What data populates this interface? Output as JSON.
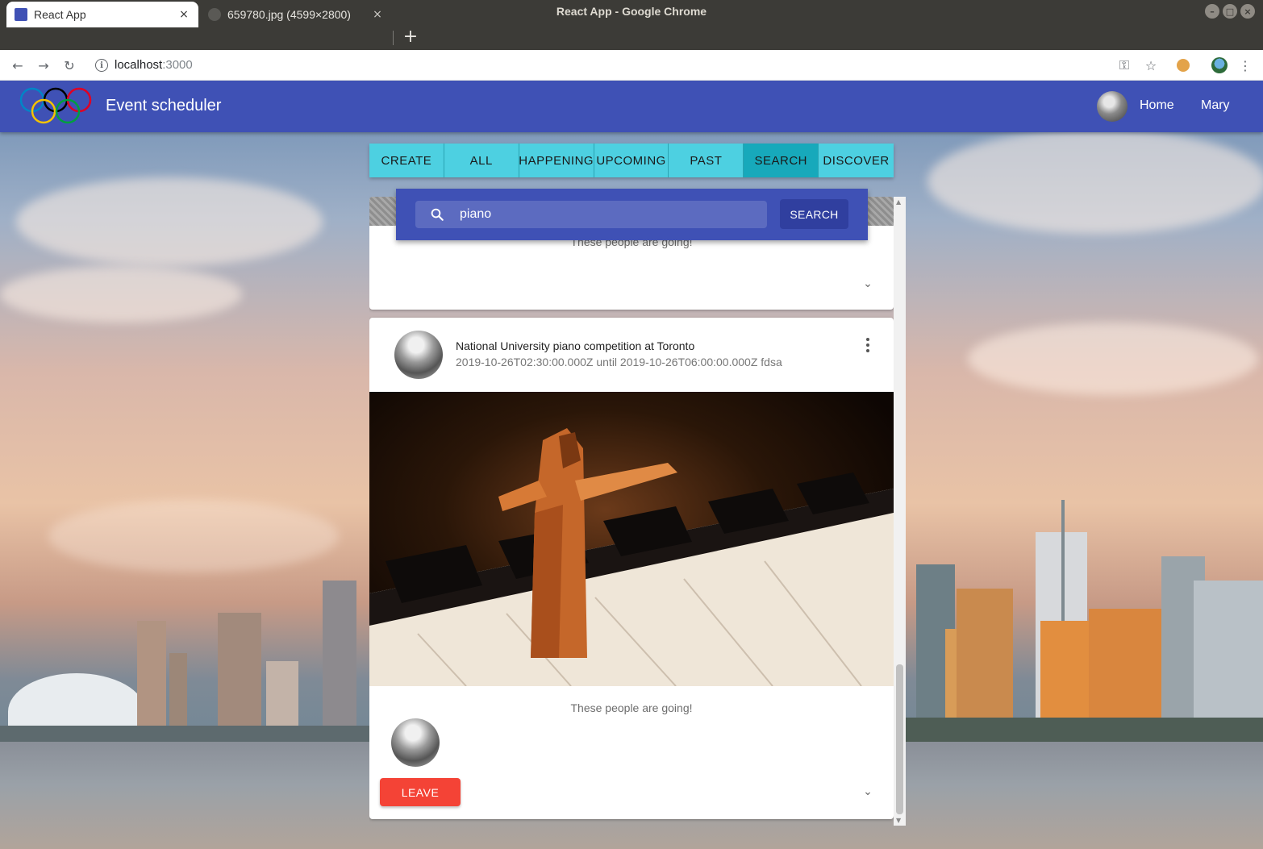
{
  "window": {
    "title": "React App - Google Chrome"
  },
  "tabs": [
    {
      "title": "React App",
      "close": "×"
    },
    {
      "title": "659780.jpg (4599×2800)",
      "close": "×"
    }
  ],
  "toolbar": {
    "url_host": "localhost",
    "url_port": ":3000",
    "icons": [
      "back-icon",
      "forward-icon",
      "reload-icon",
      "info-icon",
      "key-icon",
      "star-icon",
      "cookie-icon",
      "profile-icon",
      "menu-icon"
    ]
  },
  "appbar": {
    "title": "Event scheduler",
    "nav": {
      "home": "Home",
      "user": "Mary"
    }
  },
  "filters": {
    "items": [
      "CREATE",
      "ALL",
      "HAPPENING",
      "UPCOMING",
      "PAST",
      "SEARCH",
      "DISCOVER"
    ],
    "selected": "SEARCH"
  },
  "search": {
    "query": "piano",
    "button": "SEARCH"
  },
  "events": [
    {
      "going_label": "These people are going!"
    },
    {
      "title": "National University piano competition at Toronto",
      "subtitle": "2019-10-26T02:30:00.000Z until 2019-10-26T06:00:00.000Z fdsa",
      "going_label": "These people are going!",
      "action": "LEAVE"
    }
  ],
  "colors": {
    "primary": "#3f51b5",
    "accent_tabs": "#4dd0e1",
    "leave": "#f44336"
  }
}
